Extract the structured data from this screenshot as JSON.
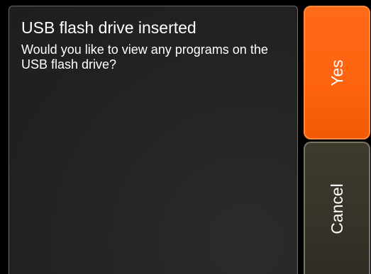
{
  "dialog": {
    "title": "USB flash drive inserted",
    "message": "Would you like to view any programs on the USB flash drive?"
  },
  "buttons": {
    "yes_label": "Yes",
    "cancel_label": "Cancel"
  },
  "colors": {
    "yes_button": "#ff6410",
    "cancel_button": "#36332a",
    "panel_background": "#232322",
    "text": "#ffffff"
  }
}
